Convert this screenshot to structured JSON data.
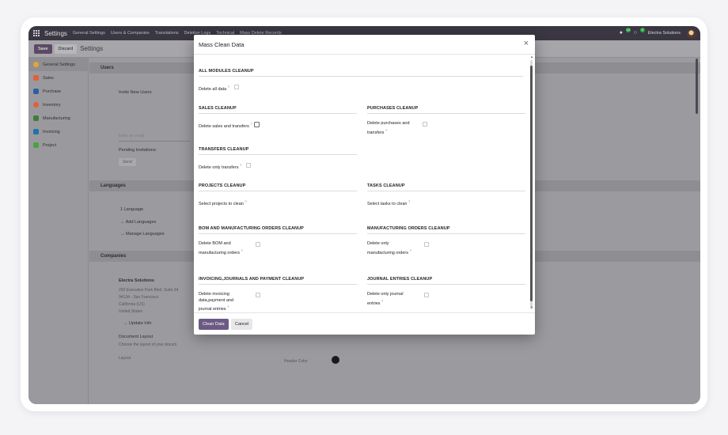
{
  "topnav": {
    "app": "Settings",
    "items": [
      "General Settings",
      "Users & Companies",
      "Translations",
      "Deletion Logs",
      "Technical",
      "Mass Delete Records"
    ],
    "company": "Electra Solutions",
    "badge_activity": "14",
    "badge_messages": "0"
  },
  "control": {
    "save_label": "Save",
    "discard_label": "Discard",
    "breadcrumb": "Settings"
  },
  "sidebar": {
    "items": [
      {
        "label": "General Settings",
        "color": "#e8a23a"
      },
      {
        "label": "Sales",
        "color": "#e0603a"
      },
      {
        "label": "Purchase",
        "color": "#2c5ea8"
      },
      {
        "label": "Inventory",
        "color": "#e0603a"
      },
      {
        "label": "Manufacturing",
        "color": "#3e7c3e"
      },
      {
        "label": "Invoicing",
        "color": "#1f73a8"
      },
      {
        "label": "Project",
        "color": "#4aa04a"
      }
    ]
  },
  "background": {
    "users_header": "Users",
    "invite_label": "Invite New Users",
    "email_placeholder": "Enter an email",
    "pending_label": "Pending Invitations:",
    "send_label": "Send",
    "languages_header": "Languages",
    "language_count": "1 Language",
    "add_languages": "→ Add Languages",
    "manage_languages": "→ Manage Languages",
    "companies_header": "Companies",
    "company_name": "Electra Solutions",
    "address_1": "250 Executive Park Blvd, Suite 34",
    "address_2": "94134 - San Francisco",
    "address_3": "California (US)",
    "address_4": "United States",
    "update_info": "→ Update Info",
    "doc_layout_label": "Document Layout",
    "doc_layout_desc": "Choose the layout of your docum",
    "layout_label": "Layout",
    "header_color": "Header Color"
  },
  "modal": {
    "title": "Mass Clean Data",
    "close": "×",
    "all_modules_title": "ALL MODULES CLEANUP",
    "delete_all_label": "Delete all data",
    "sales_title": "SALES CLEANUP",
    "sales_label": "Delete sales and transfers",
    "purchases_title": "PURCHASES CLEANUP",
    "purchases_label": "Delete purchases and transfers",
    "transfers_title": "TRANSFERS CLEANUP",
    "transfers_label": "Delete only transfers",
    "projects_title": "PROJECTS CLEANUP",
    "projects_label": "Select projects to clean",
    "tasks_title": "TASKS CLEANUP",
    "tasks_label": "Select tasks to clean",
    "bom_title": "BOM AND MANUFACTURING ORDERS CLEANUP",
    "bom_label": "Delete BOM and manufacturing orders",
    "mo_title": "MANUFACTURING ORDERS CLEANUP",
    "mo_label": "Delete only manufacturing orders",
    "invoicing_title": "INVOICING,JOURNALS AND PAYMENT CLEANUP",
    "invoicing_label": "Delete invoicing data,payment and journal entries",
    "journal_title": "JOURNAL ENTRIES CLEANUP",
    "journal_label": "Delete only journal entries",
    "help_mark": "?",
    "clean_label": "Clean Data",
    "cancel_label": "Cancel"
  }
}
